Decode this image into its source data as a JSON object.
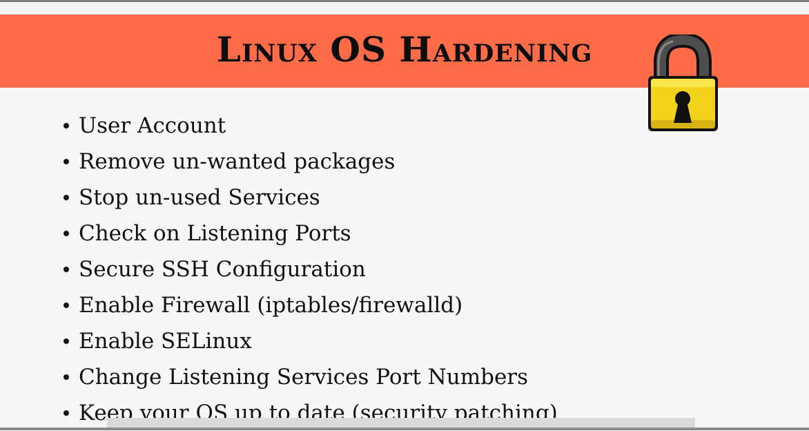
{
  "slide": {
    "title": "Linux OS Hardening",
    "accent_color": "#fe6b48",
    "icon": "padlock-icon",
    "bullets": [
      "User Account",
      "Remove un-wanted packages",
      "Stop un-used Services",
      "Check on Listening Ports",
      "Secure SSH Configuration",
      "Enable Firewall (iptables/firewalld)",
      "Enable SELinux",
      "Change Listening Services Port Numbers",
      "Keep your OS up to date (security patching)"
    ]
  }
}
